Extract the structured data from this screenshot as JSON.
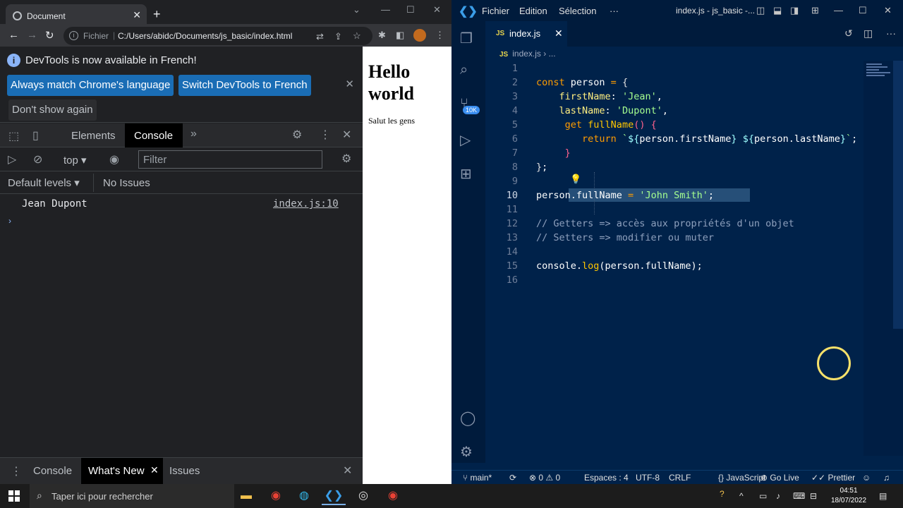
{
  "chrome": {
    "tab_title": "Document",
    "new_tab": "+",
    "scheme": "Fichier",
    "url": "C:/Users/abidc/Documents/js_basic/index.html"
  },
  "devtools": {
    "infobar_message": "DevTools is now available in French!",
    "btn_match": "Always match Chrome's language",
    "btn_switch": "Switch DevTools to French",
    "btn_dont_show": "Don't show again",
    "tab_elements": "Elements",
    "tab_console": "Console",
    "context": "top",
    "filter_placeholder": "Filter",
    "levels": "Default levels",
    "issues": "No Issues",
    "log_text": "Jean Dupont",
    "log_source": "index.js:10",
    "drawer_console": "Console",
    "drawer_whatsnew": "What's New",
    "drawer_issues": "Issues"
  },
  "page": {
    "heading": "Hello world",
    "paragraph": "Salut les gens"
  },
  "vscode": {
    "menu_file": "Fichier",
    "menu_edit": "Edition",
    "menu_selection": "Sélection",
    "menu_more": "···",
    "window_title": "index.js - js_basic -...",
    "tab_name": "index.js",
    "breadcrumb_file": "index.js",
    "breadcrumb_more": "...",
    "badge": "10K",
    "line_numbers": [
      "1",
      "2",
      "3",
      "4",
      "5",
      "6",
      "7",
      "8",
      "9",
      "10",
      "11",
      "12",
      "13",
      "14",
      "15",
      "16"
    ],
    "status": {
      "branch": "main*",
      "problems": "⊗ 0 ⚠ 0",
      "spaces": "Espaces : 4",
      "encoding": "UTF-8",
      "eol": "CRLF",
      "language": "JavaScript",
      "golive": "Go Live",
      "prettier": "Prettier"
    }
  },
  "taskbar": {
    "search_placeholder": "Taper ici pour rechercher",
    "time": "04:51",
    "date": "18/07/2022"
  }
}
